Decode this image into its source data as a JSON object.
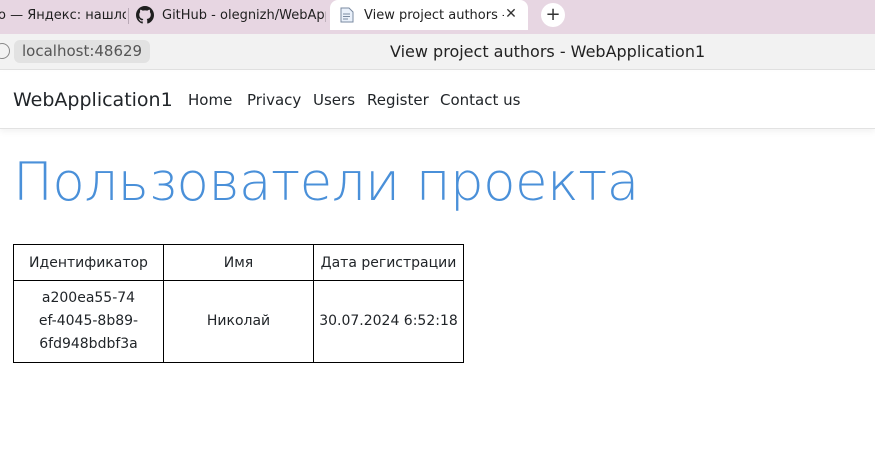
{
  "browser": {
    "tabs": [
      {
        "label": "о — Яндекс: нашлось"
      },
      {
        "label": "GitHub - olegnizh/WebApp"
      },
      {
        "label": "View project authors - W"
      }
    ],
    "close_glyph": "✕",
    "new_tab_glyph": "+",
    "url": "localhost:48629",
    "page_title": "View project authors - WebApplication1"
  },
  "navbar": {
    "brand": "WebApplication1",
    "links": [
      "Home",
      "Privacy",
      "Users",
      "Register",
      "Contact us"
    ]
  },
  "main": {
    "heading": "Пользователи проекта",
    "table": {
      "headers": [
        "Идентификатор",
        "Имя",
        "Дата регистрации"
      ],
      "rows": [
        [
          "a200ea55-74ef-4045-8b89-6fd948bdbf3a",
          "Николай",
          "30.07.2024 6:52:18"
        ]
      ]
    }
  },
  "colors": {
    "heading": "#4a90d9",
    "tabstrip": "#e7d6e2"
  },
  "icons": [
    "github-icon",
    "document-icon",
    "site-info-icon"
  ]
}
